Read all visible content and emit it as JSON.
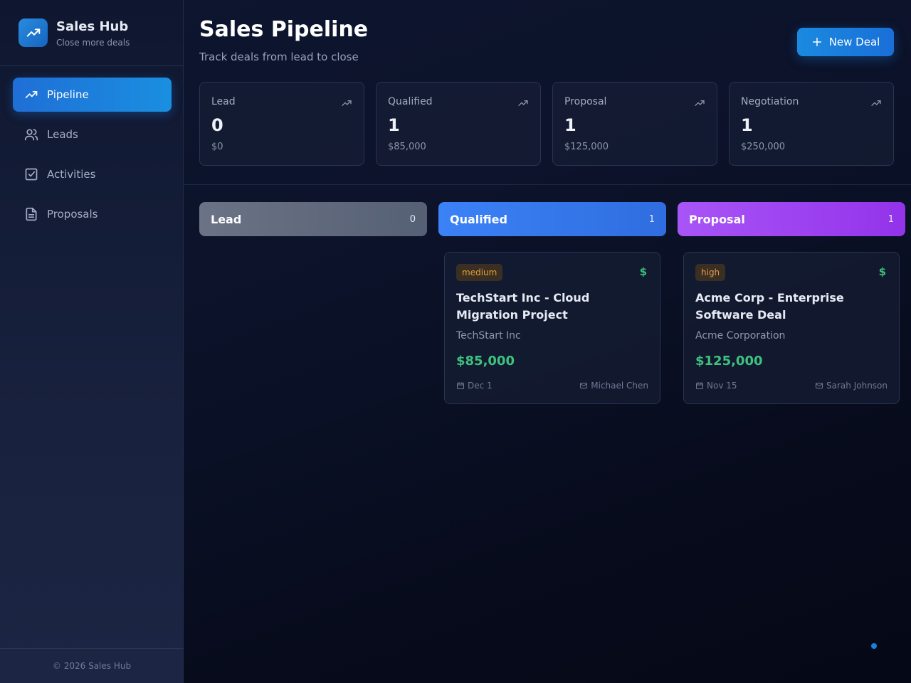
{
  "brand": {
    "title": "Sales Hub",
    "subtitle": "Close more deals"
  },
  "nav": {
    "items": [
      {
        "label": "Pipeline",
        "icon": "trending-up-icon",
        "active": true
      },
      {
        "label": "Leads",
        "icon": "users-icon",
        "active": false
      },
      {
        "label": "Activities",
        "icon": "checkbox-icon",
        "active": false
      },
      {
        "label": "Proposals",
        "icon": "file-text-icon",
        "active": false
      }
    ]
  },
  "footer": {
    "text": "© 2026 Sales Hub"
  },
  "header": {
    "title": "Sales Pipeline",
    "subtitle": "Track deals from lead to close",
    "new_deal_label": "New Deal"
  },
  "stats": [
    {
      "label": "Lead",
      "count": "0",
      "value": "$0"
    },
    {
      "label": "Qualified",
      "count": "1",
      "value": "$85,000"
    },
    {
      "label": "Proposal",
      "count": "1",
      "value": "$125,000"
    },
    {
      "label": "Negotiation",
      "count": "1",
      "value": "$250,000"
    }
  ],
  "columns": [
    {
      "name": "Lead",
      "count": "0",
      "color": "#6b7386"
    },
    {
      "name": "Qualified",
      "count": "1",
      "color": "#3b82f6"
    },
    {
      "name": "Proposal",
      "count": "1",
      "color": "#a855f7"
    }
  ],
  "deals": [
    {
      "priority": "medium",
      "title": "TechStart Inc - Cloud Migration Project",
      "company": "TechStart Inc",
      "value": "$85,000",
      "date": "Dec 1",
      "owner": "Michael Chen"
    },
    {
      "priority": "high",
      "title": "Acme Corp - Enterprise Software Deal",
      "company": "Acme Corporation",
      "value": "$125,000",
      "date": "Nov 15",
      "owner": "Sarah Johnson"
    }
  ],
  "colors": {
    "accent": "#1a8fe0",
    "money": "#3ec27f",
    "background": "#0b1228"
  }
}
